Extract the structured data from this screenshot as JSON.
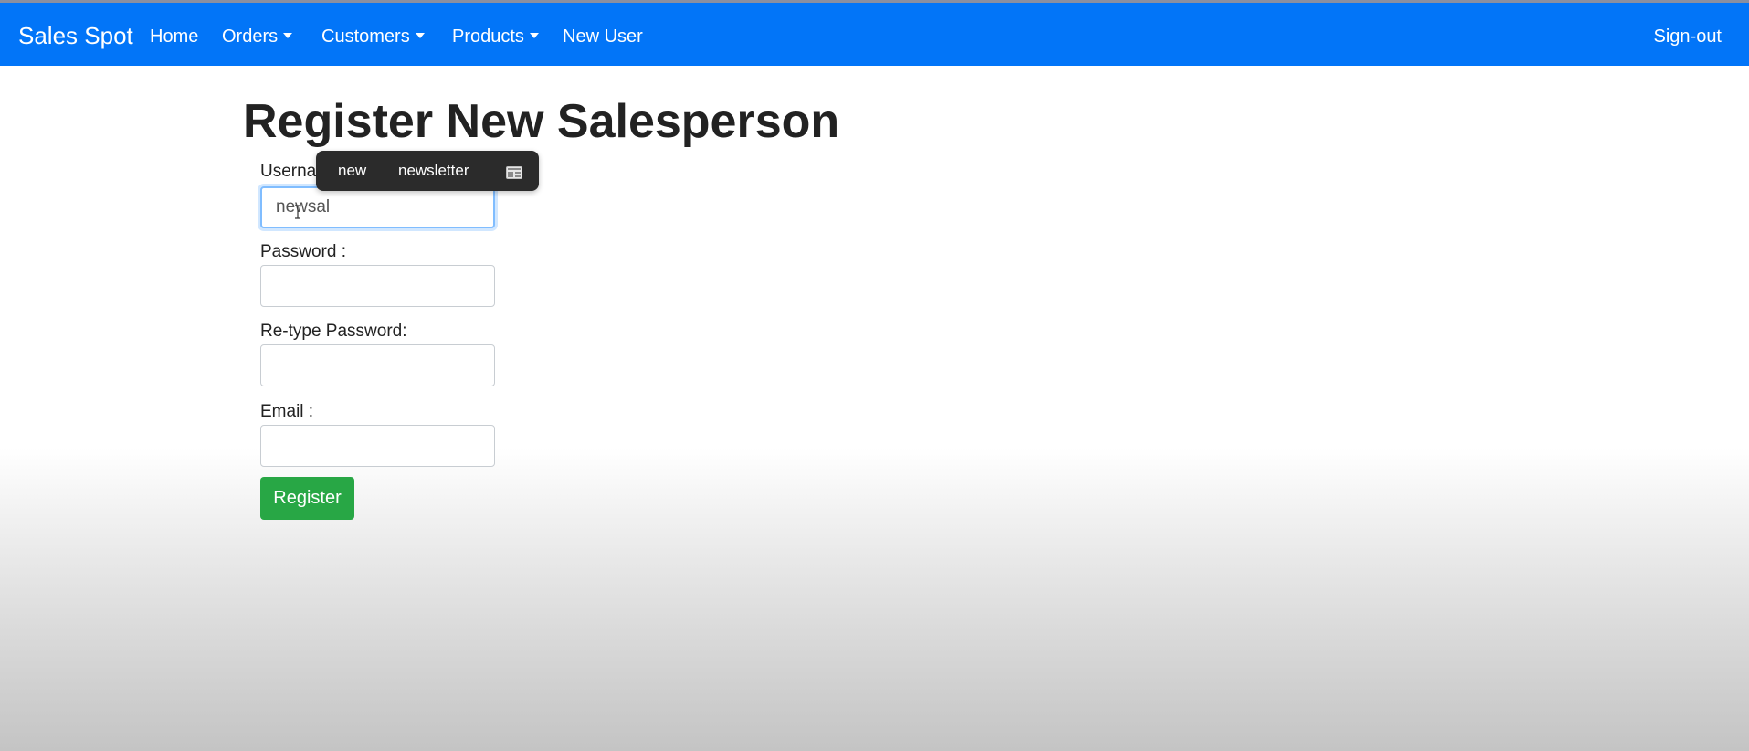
{
  "navbar": {
    "brand": "Sales Spot",
    "items": [
      {
        "label": "Home",
        "dropdown": false
      },
      {
        "label": "Orders",
        "dropdown": true
      },
      {
        "label": "Customers",
        "dropdown": true
      },
      {
        "label": "Products",
        "dropdown": true
      },
      {
        "label": "New User",
        "dropdown": false
      }
    ],
    "signout": "Sign-out",
    "background": "#0275f8"
  },
  "page": {
    "title": "Register New Salesperson"
  },
  "form": {
    "username": {
      "label": "Userna",
      "value": "newsal"
    },
    "password": {
      "label": "Password :",
      "value": ""
    },
    "retype_password": {
      "label": "Re-type Password:",
      "value": ""
    },
    "email": {
      "label": "Email :",
      "value": ""
    },
    "register_label": "Register",
    "register_color": "#28a745"
  },
  "autocomplete": {
    "suggestions": [
      "new",
      "newsletter"
    ],
    "icon": "keyboard-icon"
  }
}
